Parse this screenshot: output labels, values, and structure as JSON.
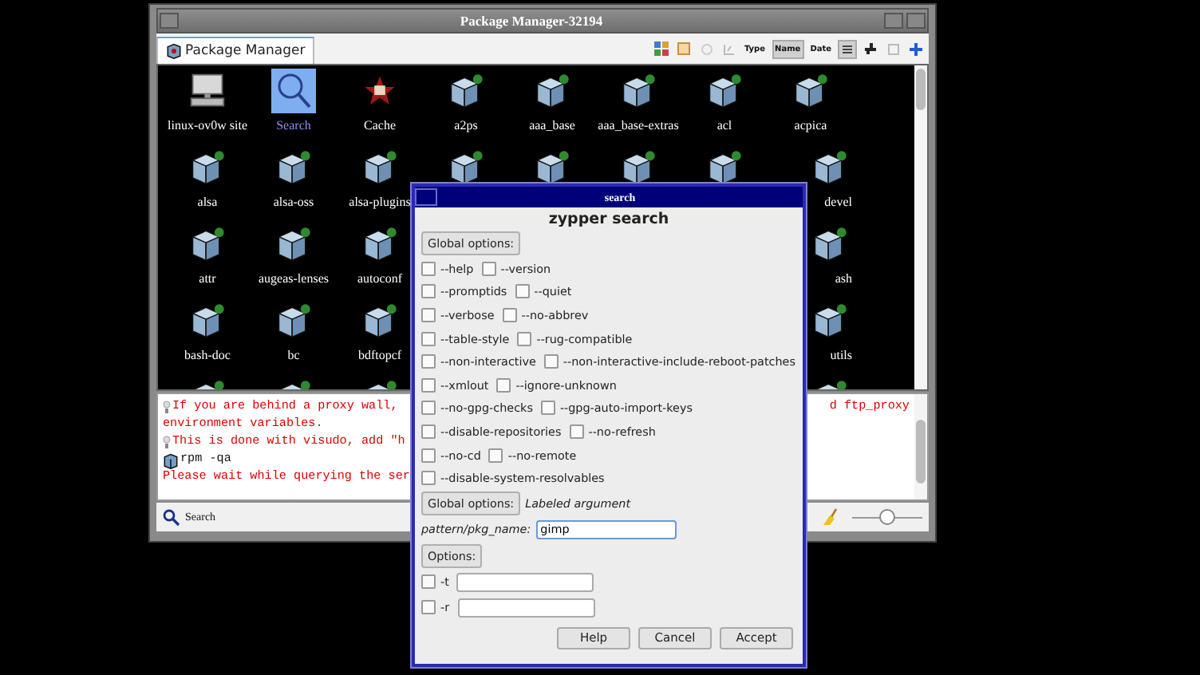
{
  "window": {
    "title": "Package Manager-32194"
  },
  "tab": {
    "label": "Package Manager",
    "selected": true
  },
  "toolbar": [
    {
      "kind": "grid",
      "selected": false
    },
    {
      "kind": "sheet",
      "selected": false
    },
    {
      "kind": "circle",
      "selected": false
    },
    {
      "kind": "chart",
      "selected": false
    },
    {
      "kind": "text",
      "label": "Type",
      "selected": false
    },
    {
      "kind": "text",
      "label": "Name",
      "selected": true
    },
    {
      "kind": "text",
      "label": "Date",
      "selected": false
    },
    {
      "kind": "list",
      "selected": true
    },
    {
      "kind": "puzzle",
      "selected": false
    },
    {
      "kind": "page",
      "selected": false
    },
    {
      "kind": "plus",
      "selected": false
    }
  ],
  "grid_rows": [
    {
      "items": [
        {
          "kind": "host",
          "label": "linux-ov0w site",
          "selected": false
        },
        {
          "kind": "search",
          "label": "Search",
          "selected": true
        },
        {
          "kind": "cache",
          "label": "Cache",
          "selected": false
        },
        {
          "kind": "package",
          "label": "a2ps",
          "selected": false
        },
        {
          "kind": "package",
          "label": "aaa_base",
          "selected": false
        },
        {
          "kind": "package",
          "label": "aaa_base-extras",
          "selected": false
        },
        {
          "kind": "package",
          "label": "acl",
          "selected": false
        },
        {
          "kind": "package",
          "label": "acpica",
          "selected": false
        }
      ]
    },
    {
      "items": [
        {
          "kind": "package",
          "label": "alsa",
          "selected": false
        },
        {
          "kind": "package",
          "label": "alsa-oss",
          "selected": false
        },
        {
          "kind": "package",
          "label": "alsa-plugins",
          "selected": false
        },
        {
          "kind": "package",
          "selected": false
        },
        {
          "kind": "package",
          "selected": false
        },
        {
          "kind": "package",
          "selected": false
        },
        {
          "kind": "package",
          "selected": false
        }
      ],
      "right": [
        {
          "kind": "package",
          "label": "devel",
          "selected": false
        }
      ]
    },
    {
      "items": [
        {
          "kind": "package",
          "label": "attr",
          "selected": false
        },
        {
          "kind": "package",
          "label": "augeas-lenses",
          "selected": false
        },
        {
          "kind": "package",
          "label": "autoconf",
          "selected": false
        }
      ],
      "right": [
        {
          "kind": "package",
          "label": "ash",
          "selected": false
        }
      ]
    },
    {
      "items": [
        {
          "kind": "package",
          "label": "bash-doc",
          "selected": false
        },
        {
          "kind": "package",
          "label": "bc",
          "selected": false
        },
        {
          "kind": "package",
          "label": "bdftopcf",
          "selected": false
        }
      ],
      "right": [
        {
          "kind": "package",
          "label": "utils",
          "selected": false
        }
      ]
    },
    {
      "items": [
        {
          "kind": "package",
          "selected": false
        },
        {
          "kind": "package",
          "selected": false
        },
        {
          "kind": "package",
          "selected": false
        }
      ],
      "right": [
        {
          "kind": "package",
          "selected": false
        }
      ]
    }
  ],
  "log": [
    {
      "kind": "tip",
      "text": "If you are behind a proxy wall,",
      "text_right": "d ftp_proxy"
    },
    {
      "kind": "plain",
      "text": "environment variables."
    },
    {
      "kind": "tip",
      "text": "This is done with visudo, add \"h"
    },
    {
      "kind": "command",
      "text": "rpm -qa"
    },
    {
      "kind": "plain",
      "text": "Please wait while querying the ser"
    }
  ],
  "status_bar": {
    "label": "Search",
    "zoom": {
      "level": 0.5
    }
  },
  "dialog": {
    "title": "search",
    "heading": "zypper search",
    "global_button": "Global options:",
    "options": [
      [
        {
          "label": "--help",
          "checked": false
        },
        {
          "label": "--version",
          "checked": false
        }
      ],
      [
        {
          "label": "--promptids",
          "checked": false
        },
        {
          "label": "--quiet",
          "checked": false
        }
      ],
      [
        {
          "label": "--verbose",
          "checked": false
        },
        {
          "label": "--no-abbrev",
          "checked": false
        }
      ],
      [
        {
          "label": "--table-style",
          "checked": false
        },
        {
          "label": "--rug-compatible",
          "checked": false
        }
      ],
      [
        {
          "label": "--non-interactive",
          "checked": false
        },
        {
          "label": "--non-interactive-include-reboot-patches",
          "checked": false
        }
      ],
      [
        {
          "label": "--xmlout",
          "checked": false
        },
        {
          "label": "--ignore-unknown",
          "checked": false
        }
      ],
      [
        {
          "label": "--no-gpg-checks",
          "checked": false
        },
        {
          "label": "--gpg-auto-import-keys",
          "checked": false
        }
      ],
      [
        {
          "label": "--disable-repositories",
          "checked": false
        },
        {
          "label": "--no-refresh",
          "checked": false
        }
      ],
      [
        {
          "label": "--no-cd",
          "checked": false
        },
        {
          "label": "--no-remote",
          "checked": false
        }
      ],
      [
        {
          "label": "--disable-system-resolvables",
          "checked": false
        }
      ]
    ],
    "global_button_2": "Global options:",
    "argument_note": "Labeled argument",
    "pattern": {
      "label": "pattern/pkg_name:",
      "value": "gimp"
    },
    "options_button": "Options:",
    "flags": [
      {
        "label": "-t",
        "checked": false
      },
      {
        "label": "-r",
        "checked": false
      }
    ],
    "buttons": [
      "Help",
      "Cancel",
      "Accept"
    ]
  }
}
